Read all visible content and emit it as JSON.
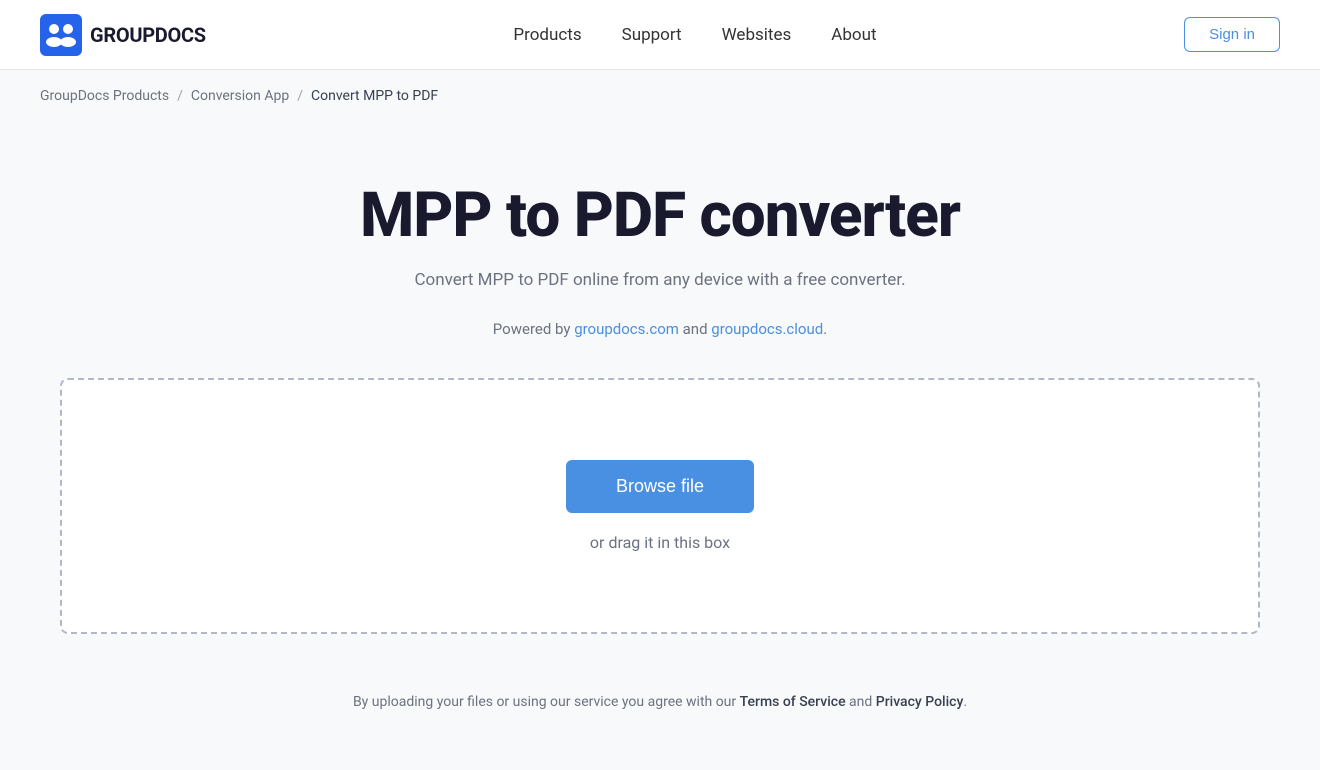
{
  "navbar": {
    "logo_text": "GROUPDOCS",
    "nav_items": [
      {
        "label": "Products",
        "id": "products"
      },
      {
        "label": "Support",
        "id": "support"
      },
      {
        "label": "Websites",
        "id": "websites"
      },
      {
        "label": "About",
        "id": "about"
      }
    ],
    "sign_in_label": "Sign in"
  },
  "breadcrumb": {
    "items": [
      {
        "label": "GroupDocs Products",
        "id": "groupdocs-products"
      },
      {
        "label": "Conversion App",
        "id": "conversion-app"
      },
      {
        "label": "Convert MPP to PDF",
        "id": "convert-mpp-pdf"
      }
    ]
  },
  "hero": {
    "title": "MPP to PDF converter",
    "subtitle": "Convert MPP to PDF online from any device with a free converter.",
    "powered_by_prefix": "Powered by ",
    "powered_by_link1_text": "groupdocs.com",
    "powered_by_link1_href": "#",
    "powered_by_and": " and ",
    "powered_by_link2_text": "groupdocs.cloud",
    "powered_by_link2_href": "#",
    "powered_by_suffix": "."
  },
  "upload": {
    "browse_label": "Browse file",
    "drag_text": "or drag it in this box"
  },
  "footer_note": {
    "prefix": "By uploading your files or using our service you agree with our ",
    "tos_label": "Terms of Service",
    "and": " and ",
    "privacy_label": "Privacy Policy",
    "suffix": "."
  }
}
